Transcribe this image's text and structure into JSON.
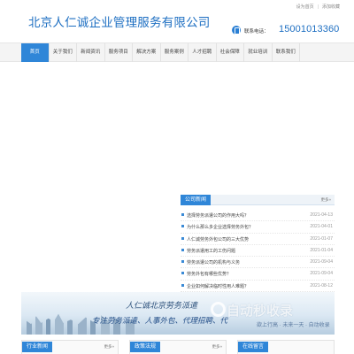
{
  "header": {
    "site_title": "北京人仁诚企业管理服务有限公司",
    "top_links": [
      "设为首页",
      "添加收藏"
    ],
    "hotline_label": "联系电话：",
    "hotline_number": "15001013360",
    "brand_color": "#2f86d8"
  },
  "nav": {
    "items": [
      {
        "label": "首页",
        "active": true
      },
      {
        "label": "关于我们",
        "active": false
      },
      {
        "label": "新闻资讯",
        "active": false
      },
      {
        "label": "服务项目",
        "active": false
      },
      {
        "label": "解决方案",
        "active": false
      },
      {
        "label": "服务案例",
        "active": false
      },
      {
        "label": "人才招聘",
        "active": false
      },
      {
        "label": "社会保障",
        "active": false
      },
      {
        "label": "就业培训",
        "active": false
      },
      {
        "label": "联系我们",
        "active": false
      }
    ]
  },
  "news": {
    "title": "公司新闻",
    "more": "更多»",
    "items": [
      {
        "title": "选择劳务派遣公司的作用大吗？",
        "date": "2021-04-13"
      },
      {
        "title": "为什么那么多企业选择劳务外包？",
        "date": "2021-04-01"
      },
      {
        "title": "人仁诚劳务外包公司的三大优势",
        "date": "2021-01-07"
      },
      {
        "title": "劳务派遣用工的工伤问题",
        "date": "2021-01-04"
      },
      {
        "title": "劳务派遣公司的机构与义务",
        "date": "2021-09-04"
      },
      {
        "title": "劳务外包有哪些优势？",
        "date": "2021-09-04"
      },
      {
        "title": "企业如何解决临时性用人难题？",
        "date": "2021-08-12"
      }
    ]
  },
  "promo": {
    "line1": "人仁诚北京劳务派遣",
    "line2": "专注劳务派遣、人事外包、代理招聘、代",
    "line3": "欲上行高 · 未来一天 · 自动收录",
    "watermark": "自动秒收录"
  },
  "bottom_sections": [
    {
      "title": "行业新闻",
      "more": "更多»"
    },
    {
      "title": "政策法规",
      "more": "更多»"
    },
    {
      "title": "在线留言",
      "more": ""
    }
  ]
}
